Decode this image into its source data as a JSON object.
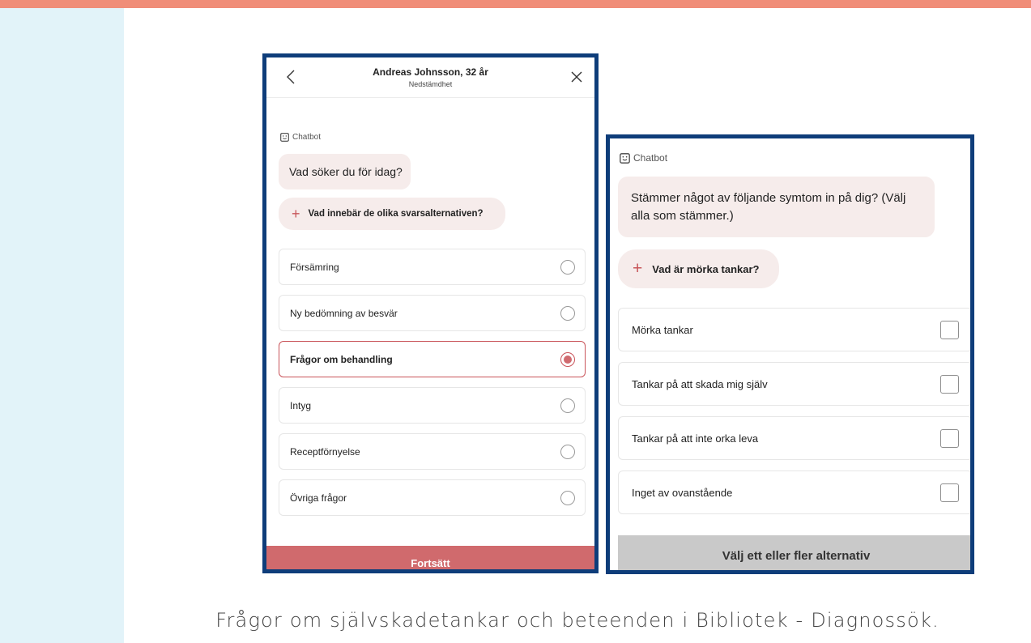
{
  "colors": {
    "top_bar": "#f08d78",
    "side_strip": "#e2f3f9",
    "frame": "#0e3d7a",
    "accent": "#c9545a",
    "bubble": "#f6eceb"
  },
  "left_panel": {
    "header": {
      "title": "Andreas Johnsson, 32 år",
      "subtitle": "Nedstämdhet",
      "back_icon": "chevron-left-icon",
      "close_icon": "close-icon"
    },
    "chatbot_label": "Chatbot",
    "question": "Vad söker du för idag?",
    "info_pill": "Vad innebär de olika svarsalternativen?",
    "options": [
      {
        "label": "Försämring",
        "selected": false
      },
      {
        "label": "Ny bedömning av besvär",
        "selected": false
      },
      {
        "label": "Frågor om behandling",
        "selected": true
      },
      {
        "label": "Intyg",
        "selected": false
      },
      {
        "label": "Receptförnyelse",
        "selected": false
      },
      {
        "label": "Övriga frågor",
        "selected": false
      }
    ],
    "continue_button": "Fortsätt"
  },
  "right_panel": {
    "chatbot_label": "Chatbot",
    "question": "Stämmer något av följande symtom in på dig? (Välj alla som stämmer.)",
    "info_pill": "Vad är mörka tankar?",
    "options": [
      {
        "label": "Mörka tankar",
        "checked": false
      },
      {
        "label": "Tankar på att skada mig själv",
        "checked": false
      },
      {
        "label": "Tankar på att inte orka leva",
        "checked": false
      },
      {
        "label": "Inget av ovanstående",
        "checked": false
      }
    ],
    "submit_button": "Välj ett eller fler alternativ"
  },
  "caption": "Frågor om självskadetankar och beteenden i Bibliotek - Diagnossök."
}
